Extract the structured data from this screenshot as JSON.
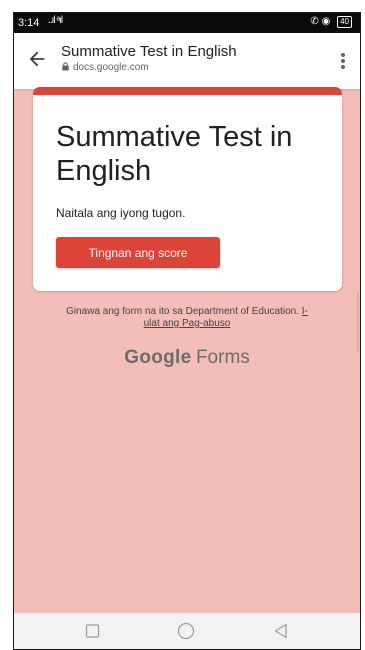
{
  "status_bar": {
    "time": "3:14",
    "signal": "..ıl ᵃıl",
    "right_icons": "✆ ◉",
    "battery": "40"
  },
  "toolbar": {
    "title": "Summative Test in English",
    "url": "docs.google.com"
  },
  "card": {
    "accent_color": "#db4437",
    "title": "Summative Test in English",
    "message": "Naitala ang iyong tugon.",
    "button_label": "Tingnan ang score"
  },
  "footer": {
    "created_by": "Ginawa ang form na ito sa Department of Education.",
    "report_link_a": "I-",
    "report_link_b": "ulat ang Pag-abuso",
    "brand_google": "Google",
    "brand_forms": "Forms"
  },
  "icons": [
    "back-arrow-icon",
    "lock-icon",
    "overflow-menu-icon",
    "square-nav-icon",
    "circle-nav-icon",
    "triangle-nav-icon"
  ]
}
